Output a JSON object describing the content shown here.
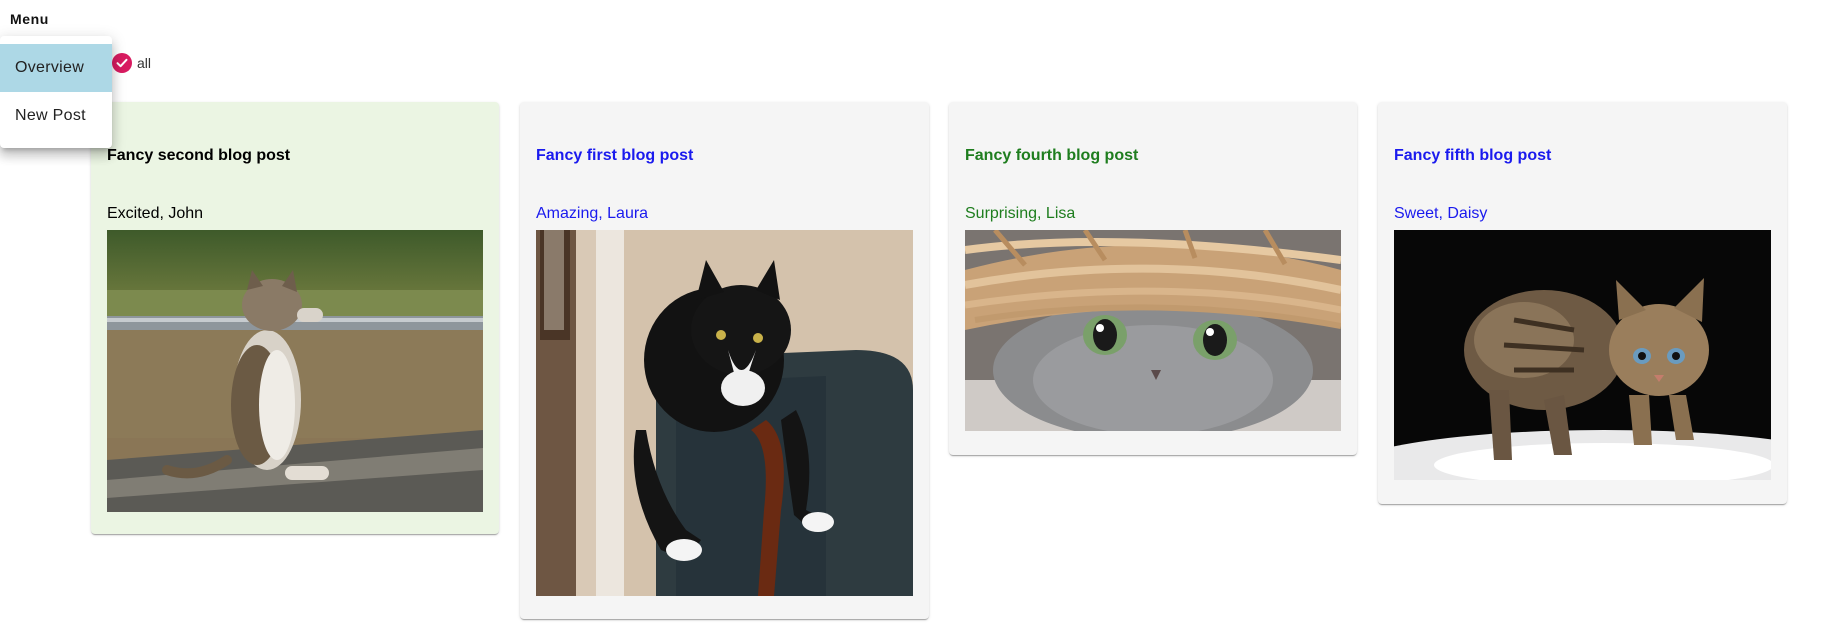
{
  "menu": {
    "label": "Menu",
    "items": [
      {
        "label": "Overview",
        "active": true
      },
      {
        "label": "New Post",
        "active": false
      }
    ]
  },
  "filter": {
    "label": "all",
    "checked": true,
    "accent": "#d81b60"
  },
  "posts": [
    {
      "title": "Fancy second blog post",
      "subtitle": "Excited, John",
      "title_color": "#000000",
      "background": "#ebf5e3",
      "image": "cat-on-railing"
    },
    {
      "title": "Fancy first blog post",
      "subtitle": "Amazing, Laura",
      "title_color": "#1a1aee",
      "background": "#f5f5f5",
      "image": "black-white-cat-on-chair"
    },
    {
      "title": "Fancy fourth blog post",
      "subtitle": "Surprising, Lisa",
      "title_color": "#1e7d1e",
      "background": "#f5f5f5",
      "image": "grey-cat-under-basket"
    },
    {
      "title": "Fancy fifth blog post",
      "subtitle": "Sweet, Daisy",
      "title_color": "#1a1aee",
      "background": "#f5f5f5",
      "image": "tabby-kitten"
    }
  ]
}
